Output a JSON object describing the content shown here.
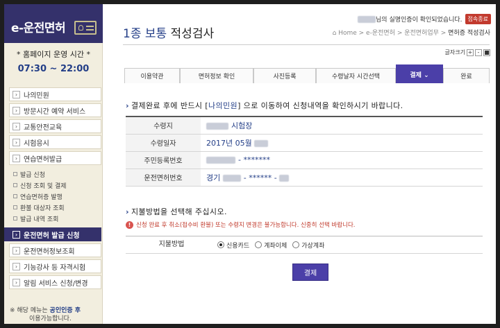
{
  "sidebar": {
    "logo": "e-운전면허",
    "hours_title": "* 홈페이지 운영 시간 *",
    "hours_time": "07:30 ~ 22:00",
    "menu_top": [
      {
        "label": "나의민원"
      },
      {
        "label": "방문시간 예약 서비스"
      },
      {
        "label": "교통안전교육"
      },
      {
        "label": "시험응시"
      },
      {
        "label": "연습면허발급"
      }
    ],
    "submenu": [
      {
        "label": "발급 신청"
      },
      {
        "label": "신청 조회 및 결제"
      },
      {
        "label": "연습면허증 발행"
      },
      {
        "label": "환불 대상자 조회"
      },
      {
        "label": "발급 내역 조회"
      }
    ],
    "menu_bottom": [
      {
        "label": "운전면허 발급 신청",
        "active": true
      },
      {
        "label": "운전면허정보조회"
      },
      {
        "label": "기능강사 등 자격시험"
      },
      {
        "label": "알림 서비스 신청/변경"
      }
    ],
    "note_prefix": "※ 해당 메뉴는",
    "note_highlight": "공인인증 후",
    "note_suffix": "이용가능합니다."
  },
  "header": {
    "user_msg": "님의 실명인증이 확인되었습니다.",
    "cert_button": "접속종료",
    "title_highlight": "1종 보통",
    "title_rest": " 적성검사",
    "breadcrumb": [
      "Home",
      "e-운전면허",
      "운전면허업무",
      "면허증 적성검사"
    ],
    "font_size_label": "글자크기",
    "font_plus": "+",
    "font_minus": "-",
    "font_reset": "■"
  },
  "steps": [
    {
      "label": "이용약관"
    },
    {
      "label": "면허정보 확인"
    },
    {
      "label": "사진등록"
    },
    {
      "label": "수령날자 시간선택"
    },
    {
      "label": "결제 ⌄",
      "active": true
    },
    {
      "label": "완료"
    }
  ],
  "notice": {
    "prefix": "결제완료 후에 반드시 [",
    "link": "나의민원",
    "suffix": "] 으로 이동하여 신청내역을 확인하시기 바랍니다."
  },
  "info_rows": [
    {
      "label": "수령지",
      "value": "시험장"
    },
    {
      "label": "수령일자",
      "value": "2017년 05월"
    },
    {
      "label": "주민등록번호",
      "value": "- *******"
    },
    {
      "label": "운전면허번호",
      "value": "경기",
      "value2": "- ****** -"
    }
  ],
  "payment": {
    "heading": "지불방법을 선택해 주십시오.",
    "warning": "신청 완료 후 취소(접수비 환불) 또는 수령지 변경은 불가능합니다. 신중히 선택 바랍니다.",
    "label": "지불방법",
    "options": [
      {
        "label": "신용카드",
        "checked": true
      },
      {
        "label": "계좌이체",
        "checked": false
      },
      {
        "label": "가상계좌",
        "checked": false
      }
    ],
    "submit": "결제"
  }
}
